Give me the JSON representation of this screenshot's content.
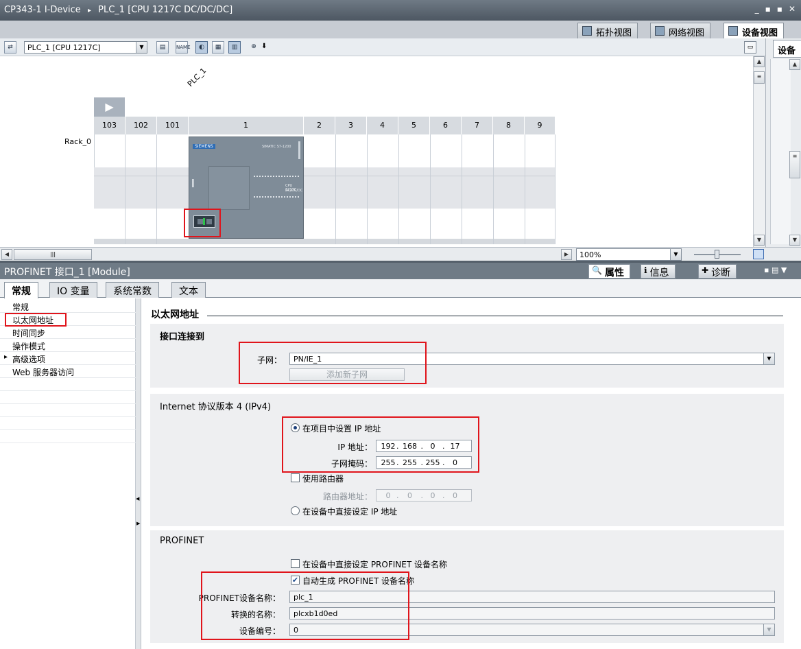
{
  "window": {
    "title_a": "CP343-1 I-Device",
    "title_sep": "▸",
    "title_b": "PLC_1 [CPU 1217C DC/DC/DC]",
    "buttons": [
      "_",
      "▪",
      "▪",
      "✕"
    ]
  },
  "view_tabs": [
    {
      "label": "拓扑视图",
      "icon": "topology-view-icon"
    },
    {
      "label": "网络视图",
      "icon": "network-view-icon"
    },
    {
      "label": "设备视图",
      "icon": "device-view-icon",
      "active": true
    }
  ],
  "right_panel": {
    "tab_label": "设备"
  },
  "toolbar": {
    "device_select": "PLC_1 [CPU 1217C]",
    "name_icon_text": "NAME"
  },
  "canvas": {
    "device_label": "PLC_1",
    "rack_label": "Rack_0",
    "slots": [
      "103",
      "102",
      "101",
      "1",
      "2",
      "3",
      "4",
      "5",
      "6",
      "7",
      "8",
      "9"
    ],
    "cpu": {
      "brand": "SIEMENS",
      "model_line1": "SIMATIC S7-1200",
      "model_line2": "CPU 1217C",
      "model_line3": "DC/DC/DC"
    }
  },
  "zoom": {
    "value": "100%"
  },
  "inspector": {
    "title": "PROFINET 接口_1 [Module]",
    "tabs": [
      {
        "label": "属性",
        "active": true
      },
      {
        "label": "信息"
      },
      {
        "label": "诊断"
      }
    ],
    "subtabs": [
      "常规",
      "IO 变量",
      "系统常数",
      "文本"
    ]
  },
  "nav": {
    "items": [
      {
        "label": "常规",
        "selected": false
      },
      {
        "label": "以太网地址",
        "selected": true
      },
      {
        "label": "时间同步",
        "selected": false
      },
      {
        "label": "操作模式",
        "selected": false
      },
      {
        "label": "高级选项",
        "selected": false,
        "expander": "▸"
      },
      {
        "label": "Web 服务器访问",
        "selected": false
      }
    ]
  },
  "ethernet": {
    "heading": "以太网地址",
    "interface": {
      "title": "接口连接到",
      "subnet_label": "子网：",
      "subnet_value": "PN/IE_1",
      "add_subnet_button": "添加新子网"
    },
    "ipv4": {
      "title": "Internet 协议版本 4 (IPv4)",
      "set_in_project": "在项目中设置 IP 地址",
      "ip_label": "IP 地址：",
      "ip": [
        "192",
        "168",
        "0",
        "17"
      ],
      "mask_label": "子网掩码：",
      "mask": [
        "255",
        "255",
        "255",
        "0"
      ],
      "use_router": "使用路由器",
      "router_label": "路由器地址：",
      "router": [
        "0",
        "0",
        "0",
        "0"
      ],
      "set_in_device": "在设备中直接设定 IP 地址"
    },
    "profinet": {
      "title": "PROFINET",
      "set_name_in_device": "在设备中直接设定 PROFINET 设备名称",
      "auto_generate": "自动生成 PROFINET 设备名称",
      "device_name_label": "PROFINET设备名称：",
      "device_name": "plc_1",
      "converted_label": "转换的名称：",
      "converted_name": "plcxb1d0ed",
      "device_number_label": "设备编号：",
      "device_number": "0"
    }
  }
}
